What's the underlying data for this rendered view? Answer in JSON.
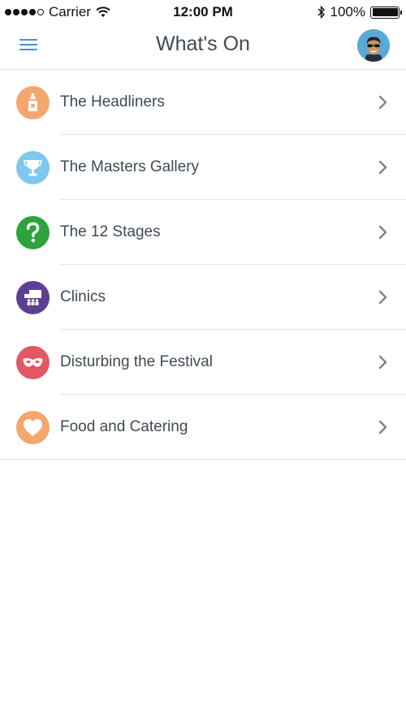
{
  "status_bar": {
    "carrier": "Carrier",
    "time": "12:00 PM",
    "battery": "100%"
  },
  "nav": {
    "title": "What's On",
    "menu_icon": "hamburger-icon",
    "avatar_icon": "user-avatar"
  },
  "categories": [
    {
      "label": "The Headliners",
      "icon": "bottle-icon",
      "color": "#f3a76f"
    },
    {
      "label": "The Masters Gallery",
      "icon": "trophy-icon",
      "color": "#7ec8ee"
    },
    {
      "label": "The 12 Stages",
      "icon": "question-icon",
      "color": "#2ea33c"
    },
    {
      "label": "Clinics",
      "icon": "presentation-icon",
      "color": "#5d3f94"
    },
    {
      "label": "Disturbing the Festival",
      "icon": "mask-icon",
      "color": "#e25763"
    },
    {
      "label": "Food and Catering",
      "icon": "heart-icon",
      "color": "#f3a76f"
    }
  ],
  "colors": {
    "accent": "#4a90c4",
    "text": "#3f4a55",
    "separator": "#e3e6e9"
  }
}
